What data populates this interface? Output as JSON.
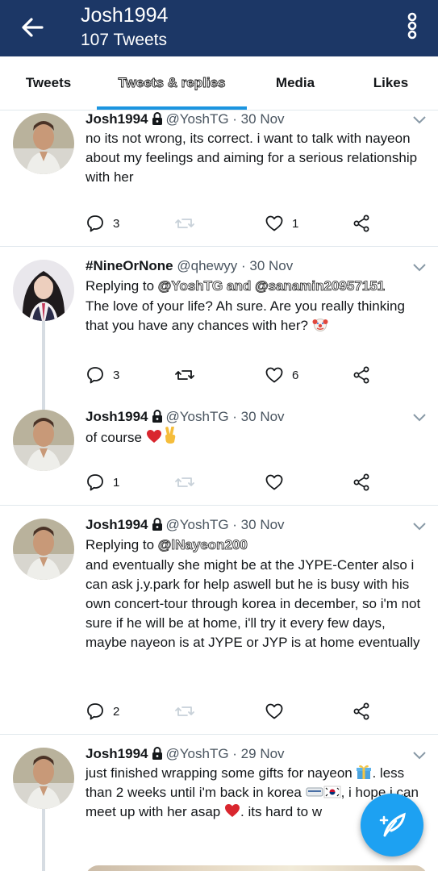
{
  "header": {
    "title": "Josh1994",
    "subtitle": "107 Tweets"
  },
  "tabs": [
    {
      "label": "Tweets"
    },
    {
      "label": "Tweets & replies"
    },
    {
      "label": "Media"
    },
    {
      "label": "Likes"
    }
  ],
  "tweets": [
    {
      "name": "Josh1994",
      "handle": "@YoshTG",
      "date": "· 30 Nov",
      "text": "no its not wrong, its correct. i want to talk with nayeon about my feelings and aiming for a serious relationship with her",
      "replies": "3",
      "retweets": "",
      "likes": "1"
    },
    {
      "name": "#NineOrNone",
      "handle": "@qhewyy",
      "date": "· 30 Nov",
      "replying_prefix": "Replying to",
      "replying_to": "@YoshTG and @sanamin20957151",
      "text": "The love of your life? Ah sure. Are you really thinking that you have any chances with her?",
      "replies": "3",
      "retweets": "",
      "likes": "6"
    },
    {
      "name": "Josh1994",
      "handle": "@YoshTG",
      "date": "· 30 Nov",
      "text": "of course",
      "replies": "1",
      "retweets": "",
      "likes": ""
    },
    {
      "name": "Josh1994",
      "handle": "@YoshTG",
      "date": "· 30 Nov",
      "replying_prefix": "Replying to",
      "replying_to": "@lNayeon200",
      "text": "and eventually she might be at the JYPE-Center also i can ask j.y.park for help aswell but he is busy with his own concert-tour through korea in december, so i'm not sure if he will be at home, i'll try it every few days, maybe nayeon is at JYPE or JYP is at home eventually",
      "replies": "2",
      "retweets": "",
      "likes": ""
    },
    {
      "name": "Josh1994",
      "handle": "@YoshTG",
      "date": "· 29 Nov",
      "text_part1": "just finished wrapping some gifts for nayeon",
      "text_part2": ". less than 2 weeks until i'm back in korea",
      "text_part3": ", i hope i can meet up with her asap",
      "text_part4": ". its hard to w"
    }
  ],
  "colors": {
    "header_bg": "#1c3766",
    "accent": "#1da1f2",
    "tab_active": "#1b95e0",
    "divider": "#e1e8ed"
  }
}
